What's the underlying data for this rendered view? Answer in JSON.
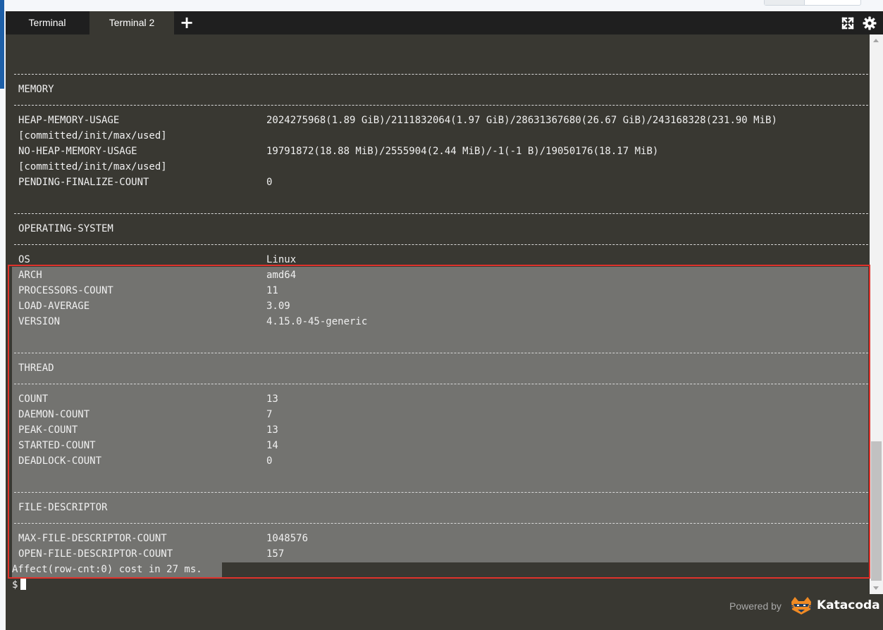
{
  "tabs": [
    {
      "label": "Terminal",
      "active": false
    },
    {
      "label": "Terminal 2",
      "active": true
    }
  ],
  "icons": {
    "add": "plus-icon",
    "expand": "expand-icon",
    "settings": "gear-icon"
  },
  "colors": {
    "terminal_bg": "#393832",
    "tabbar_bg": "#1f1f1f",
    "selection": "#737370",
    "annotation_box": "#e0322b"
  },
  "memory": {
    "title": "MEMORY",
    "rows": [
      {
        "name": "HEAP-MEMORY-USAGE",
        "value": "2024275968(1.89 GiB)/2111832064(1.97 GiB)/28631367680(26.67 GiB)/243168328(231.90 MiB)",
        "cont": "[committed/init/max/used]"
      },
      {
        "name": "NO-HEAP-MEMORY-USAGE",
        "value": "19791872(18.88 MiB)/2555904(2.44 MiB)/-1(-1 B)/19050176(18.17 MiB)",
        "cont": "[committed/init/max/used]"
      },
      {
        "name": "PENDING-FINALIZE-COUNT",
        "value": "0"
      }
    ]
  },
  "os": {
    "title": "OPERATING-SYSTEM",
    "rows": [
      {
        "name": "OS",
        "value": "Linux"
      },
      {
        "name": "ARCH",
        "value": "amd64"
      },
      {
        "name": "PROCESSORS-COUNT",
        "value": "11"
      },
      {
        "name": "LOAD-AVERAGE",
        "value": "3.09"
      },
      {
        "name": "VERSION",
        "value": "4.15.0-45-generic"
      }
    ]
  },
  "thread": {
    "title": "THREAD",
    "rows": [
      {
        "name": "COUNT",
        "value": "13"
      },
      {
        "name": "DAEMON-COUNT",
        "value": "7"
      },
      {
        "name": "PEAK-COUNT",
        "value": "13"
      },
      {
        "name": "STARTED-COUNT",
        "value": "14"
      },
      {
        "name": "DEADLOCK-COUNT",
        "value": "0"
      }
    ]
  },
  "fd": {
    "title": "FILE-DESCRIPTOR",
    "rows": [
      {
        "name": "MAX-FILE-DESCRIPTOR-COUNT",
        "value": "1048576"
      },
      {
        "name": "OPEN-FILE-DESCRIPTOR-COUNT",
        "value": "157"
      }
    ]
  },
  "status_line": "Affect(row-cnt:0) cost in 27 ms.",
  "prompt": "$",
  "footer": {
    "powered_by": "Powered by",
    "brand": "Katacoda"
  }
}
